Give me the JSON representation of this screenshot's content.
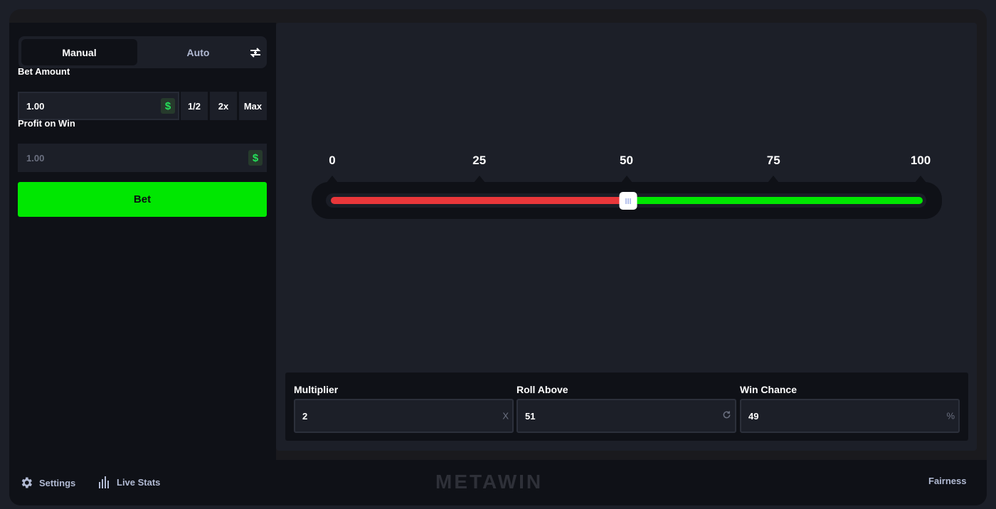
{
  "tabs": {
    "manual": "Manual",
    "auto": "Auto"
  },
  "bet_amount": {
    "label": "Bet Amount",
    "value": "1.00",
    "currency_icon": "$"
  },
  "modifiers": {
    "half": "1/2",
    "double": "2x",
    "max": "Max"
  },
  "profit": {
    "label": "Profit on Win",
    "value": "1.00",
    "currency_icon": "$"
  },
  "bet_button": "Bet",
  "slider": {
    "ticks": [
      "0",
      "25",
      "50",
      "75",
      "100"
    ],
    "value": 50,
    "min": 0,
    "max": 100,
    "lose_color": "#e9373a",
    "win_color": "#00e701"
  },
  "stats": {
    "multiplier": {
      "label": "Multiplier",
      "value": "2",
      "suffix": "X"
    },
    "roll_above": {
      "label": "Roll Above",
      "value": "51",
      "suffix_icon": "refresh-icon"
    },
    "win_chance": {
      "label": "Win Chance",
      "value": "49",
      "suffix": "%"
    }
  },
  "footer": {
    "settings": "Settings",
    "live_stats": "Live Stats",
    "logo": "METAWIN",
    "fairness": "Fairness"
  },
  "colors": {
    "accent": "#00e701",
    "background": "#0f1117",
    "panel": "#1c1f28"
  }
}
